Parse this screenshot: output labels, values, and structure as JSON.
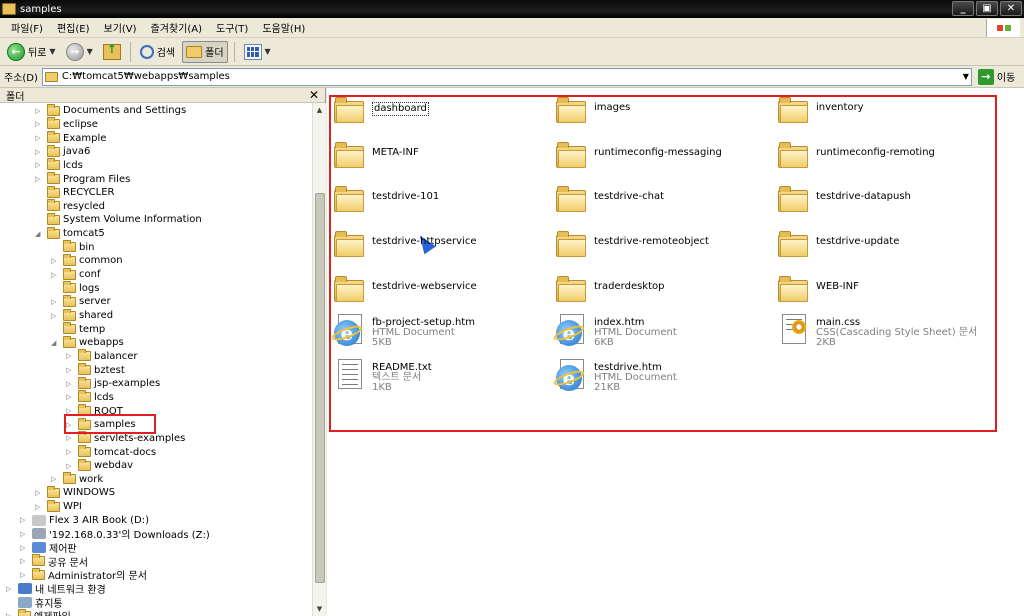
{
  "window": {
    "title": "samples"
  },
  "menu": [
    "파일(F)",
    "편집(E)",
    "보기(V)",
    "즐겨찾기(A)",
    "도구(T)",
    "도움말(H)"
  ],
  "toolbar": {
    "back_label": "뒤로",
    "search_label": "검색",
    "folders_label": "폴더"
  },
  "address": {
    "label": "주소(D)",
    "path": "C:₩tomcat5₩webapps₩samples",
    "go_label": "이동"
  },
  "left_pane": {
    "header": "폴더",
    "tree": [
      {
        "label": "Documents and Settings",
        "level": 1,
        "expander": "▷"
      },
      {
        "label": "eclipse",
        "level": 1,
        "expander": "▷"
      },
      {
        "label": "Example",
        "level": 1,
        "expander": "▷"
      },
      {
        "label": "java6",
        "level": 1,
        "expander": "▷"
      },
      {
        "label": "lcds",
        "level": 1,
        "expander": "▷"
      },
      {
        "label": "Program Files",
        "level": 1,
        "expander": "▷"
      },
      {
        "label": "RECYCLER",
        "level": 1,
        "expander": ""
      },
      {
        "label": "resycled",
        "level": 1,
        "expander": ""
      },
      {
        "label": "System Volume Information",
        "level": 1,
        "expander": ""
      },
      {
        "label": "tomcat5",
        "level": 1,
        "expander": "◢"
      },
      {
        "label": "bin",
        "level": 2,
        "expander": ""
      },
      {
        "label": "common",
        "level": 2,
        "expander": "▷"
      },
      {
        "label": "conf",
        "level": 2,
        "expander": "▷"
      },
      {
        "label": "logs",
        "level": 2,
        "expander": ""
      },
      {
        "label": "server",
        "level": 2,
        "expander": "▷"
      },
      {
        "label": "shared",
        "level": 2,
        "expander": "▷"
      },
      {
        "label": "temp",
        "level": 2,
        "expander": ""
      },
      {
        "label": "webapps",
        "level": 2,
        "expander": "◢"
      },
      {
        "label": "balancer",
        "level": 3,
        "expander": "▷"
      },
      {
        "label": "bztest",
        "level": 3,
        "expander": "▷"
      },
      {
        "label": "jsp-examples",
        "level": 3,
        "expander": "▷"
      },
      {
        "label": "lcds",
        "level": 3,
        "expander": "▷"
      },
      {
        "label": "ROOT",
        "level": 3,
        "expander": "▷"
      },
      {
        "label": "samples",
        "level": 3,
        "expander": "▷"
      },
      {
        "label": "servlets-examples",
        "level": 3,
        "expander": "▷"
      },
      {
        "label": "tomcat-docs",
        "level": 3,
        "expander": "▷"
      },
      {
        "label": "webdav",
        "level": 3,
        "expander": "▷"
      },
      {
        "label": "work",
        "level": 2,
        "expander": "▷"
      },
      {
        "label": "WINDOWS",
        "level": 1,
        "expander": "▷"
      },
      {
        "label": "WPI",
        "level": 1,
        "expander": "▷"
      },
      {
        "label": "Flex 3 AIR Book (D:)",
        "level": 0,
        "expander": "▷",
        "icon": "cd-drive-icon"
      },
      {
        "label": "'192.168.0.33'의 Downloads (Z:)",
        "level": 0,
        "expander": "▷",
        "icon": "network-drive-icon"
      },
      {
        "label": "제어판",
        "level": 0,
        "expander": "▷",
        "icon": "control-panel-icon"
      },
      {
        "label": "공유 문서",
        "level": 0,
        "expander": "▷",
        "icon": "folder-icon"
      },
      {
        "label": "Administrator의 문서",
        "level": 0,
        "expander": "▷",
        "icon": "folder-icon"
      },
      {
        "label": "내 네트워크 환경",
        "level": -1,
        "expander": "▷",
        "icon": "network-icon"
      },
      {
        "label": "휴지통",
        "level": -1,
        "expander": "",
        "icon": "recycle-bin-icon"
      },
      {
        "label": "예제파일",
        "level": -1,
        "expander": "▷",
        "icon": "folder-icon"
      }
    ]
  },
  "content": {
    "folders": [
      "dashboard",
      "images",
      "inventory",
      "META-INF",
      "runtimeconfig-messaging",
      "runtimeconfig-remoting",
      "testdrive-101",
      "testdrive-chat",
      "testdrive-datapush",
      "testdrive-httpservice",
      "testdrive-remoteobject",
      "testdrive-update",
      "testdrive-webservice",
      "traderdesktop",
      "WEB-INF"
    ],
    "files": [
      {
        "name": "fb-project-setup.htm",
        "type": "HTML Document",
        "size": "5KB",
        "icon": "ie-icon"
      },
      {
        "name": "index.htm",
        "type": "HTML Document",
        "size": "6KB",
        "icon": "ie-icon"
      },
      {
        "name": "main.css",
        "type": "CSS(Cascading Style Sheet) 문서",
        "size": "2KB",
        "icon": "css-icon"
      },
      {
        "name": "README.txt",
        "type": "텍스트 문서",
        "size": "1KB",
        "icon": "text-icon"
      },
      {
        "name": "testdrive.htm",
        "type": "HTML Document",
        "size": "21KB",
        "icon": "ie-icon"
      }
    ]
  }
}
